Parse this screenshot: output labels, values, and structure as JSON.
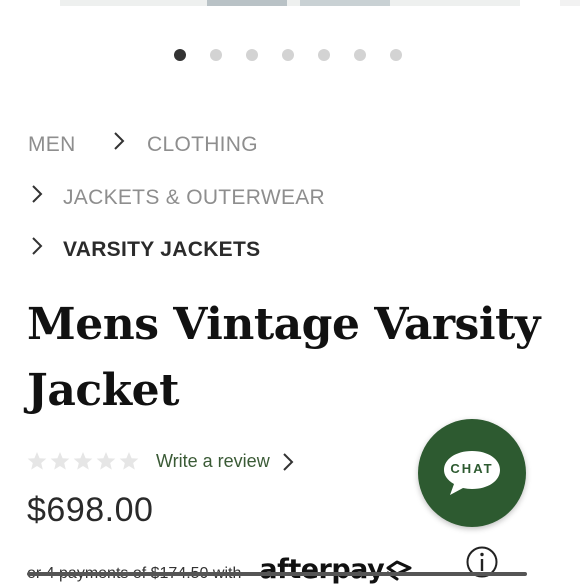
{
  "carousel": {
    "total_slides": 7,
    "active_index": 0
  },
  "breadcrumb": {
    "items": [
      {
        "label": "MEN"
      },
      {
        "label": "CLOTHING"
      },
      {
        "label": "JACKETS & OUTERWEAR"
      },
      {
        "label": "VARSITY JACKETS"
      }
    ]
  },
  "product": {
    "title_line1": "Mens Vintage Varsity",
    "title_line2": "Jacket",
    "rating": 0,
    "review_link": "Write a review",
    "price": "$698.00",
    "installments_text": "or 4 payments of $174.50 with",
    "afterpay_logo": "afterpay"
  },
  "chat": {
    "label": "CHAT",
    "color": "#2d5a30"
  },
  "colors": {
    "accent": "#2d5a30",
    "review_link": "#3a5a35"
  }
}
